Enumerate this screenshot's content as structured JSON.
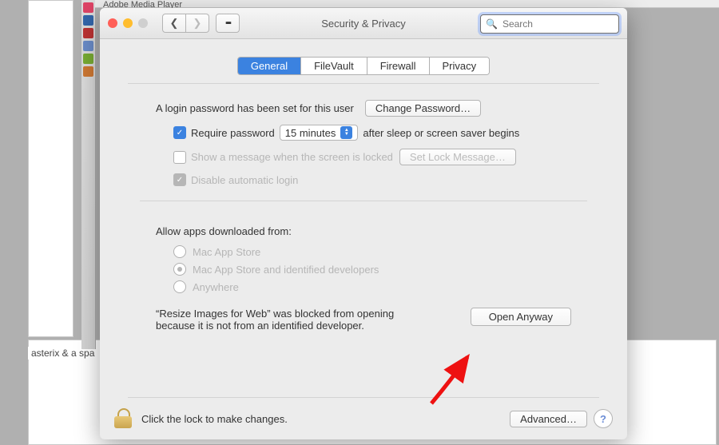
{
  "menubar_app": "Adobe Media Player",
  "background_label": "asterix & a spa",
  "window": {
    "title": "Security & Privacy",
    "search_placeholder": "Search",
    "tabs": [
      "General",
      "FileVault",
      "Firewall",
      "Privacy"
    ],
    "login_msg": "A login password has been set for this user",
    "change_pw": "Change Password…",
    "require_pw": "Require password",
    "delay_value": "15 minutes",
    "after_sleep": "after sleep or screen saver begins",
    "show_msg": "Show a message when the screen is locked",
    "set_lock": "Set Lock Message…",
    "disable_auto": "Disable automatic login",
    "allow_from": "Allow apps downloaded from:",
    "opt_mas": "Mac App Store",
    "opt_mas_dev": "Mac App Store and identified developers",
    "opt_anywhere": "Anywhere",
    "blocked_line1": "“Resize Images for Web” was blocked from opening",
    "blocked_line2": "because it is not from an identified developer.",
    "open_anyway": "Open Anyway",
    "lock_text": "Click the lock to make changes.",
    "advanced": "Advanced…"
  }
}
